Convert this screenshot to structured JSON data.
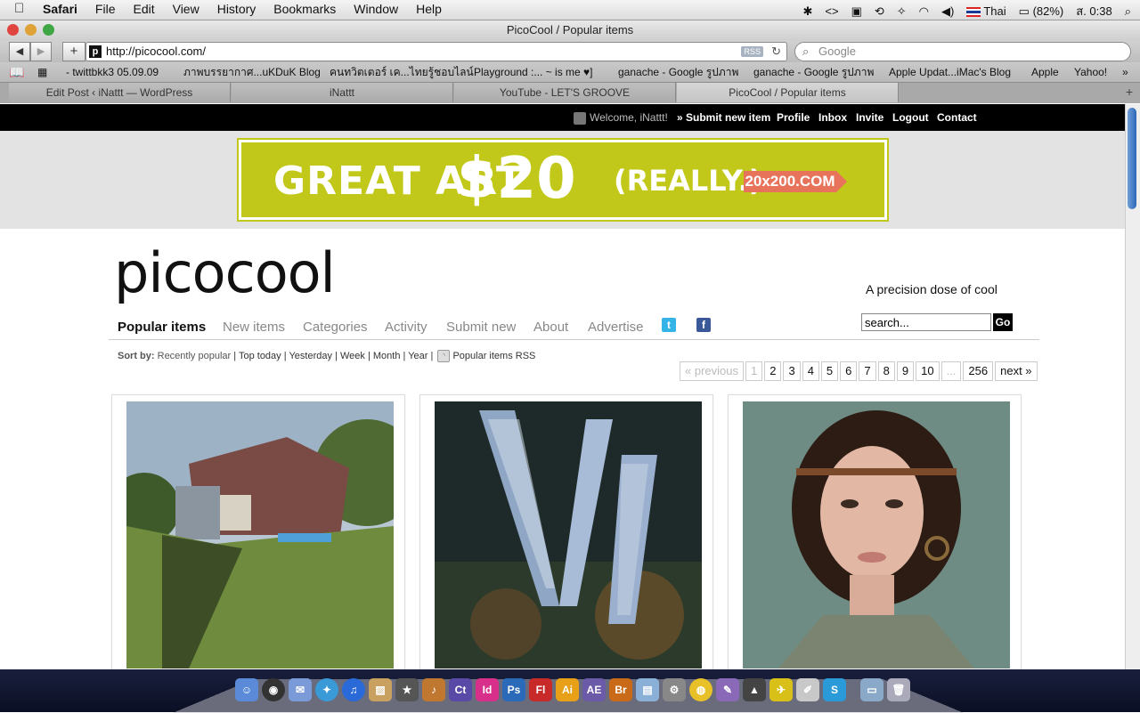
{
  "menubar": {
    "app": "Safari",
    "items": [
      "File",
      "Edit",
      "View",
      "History",
      "Bookmarks",
      "Window",
      "Help"
    ],
    "status": {
      "language": "Thai",
      "battery": "(82%)",
      "clock": "ส. 0:38"
    }
  },
  "window": {
    "title": "PicoCool / Popular items"
  },
  "toolbar": {
    "url": "http://picocool.com/",
    "rss_label": "RSS",
    "search_placeholder": "Google"
  },
  "bookmarks": [
    "- twittbkk3 05.09.09",
    "ภาพบรรยากาศ...uKDuK Blog",
    "คนทวิตเตอร์ เค...ไทยรู้ชอบไลน์",
    "Playground :... ~ is me ♥]",
    "ganache - Google รูปภาพ",
    "ganache - Google รูปภาพ",
    "Apple Updat...iMac's Blog",
    "Apple",
    "Yahoo!"
  ],
  "tabs": [
    {
      "label": "Edit Post ‹ iNattt — WordPress"
    },
    {
      "label": "iNattt"
    },
    {
      "label": "YouTube - LET'S GROOVE"
    },
    {
      "label": "PicoCool / Popular items"
    }
  ],
  "topnav": {
    "welcome": "Welcome, iNattt!",
    "submit": "» Submit new item",
    "profile": "Profile",
    "inbox": "Inbox",
    "invite": "Invite",
    "logout": "Logout",
    "contact": "Contact"
  },
  "ad": {
    "line1": "GREAT ART",
    "price": "$20",
    "line2": "(REALLY.)",
    "site": "20x200.COM",
    "bg": "#c2c81a"
  },
  "site": {
    "logo": "picocool",
    "tagline": "A precision dose of cool",
    "nav": [
      "Popular items",
      "New items",
      "Categories",
      "Activity",
      "Submit new",
      "About",
      "Advertise"
    ],
    "search_placeholder": "search...",
    "search_button": "Go"
  },
  "sort": {
    "label": "Sort by:",
    "current": "Recently popular",
    "options": [
      "Top today",
      "Yesterday",
      "Week",
      "Month",
      "Year"
    ],
    "rss": "Popular items RSS"
  },
  "pager": [
    "« previous",
    "1",
    "2",
    "3",
    "4",
    "5",
    "6",
    "7",
    "8",
    "9",
    "10",
    "...",
    "256",
    "next »"
  ]
}
